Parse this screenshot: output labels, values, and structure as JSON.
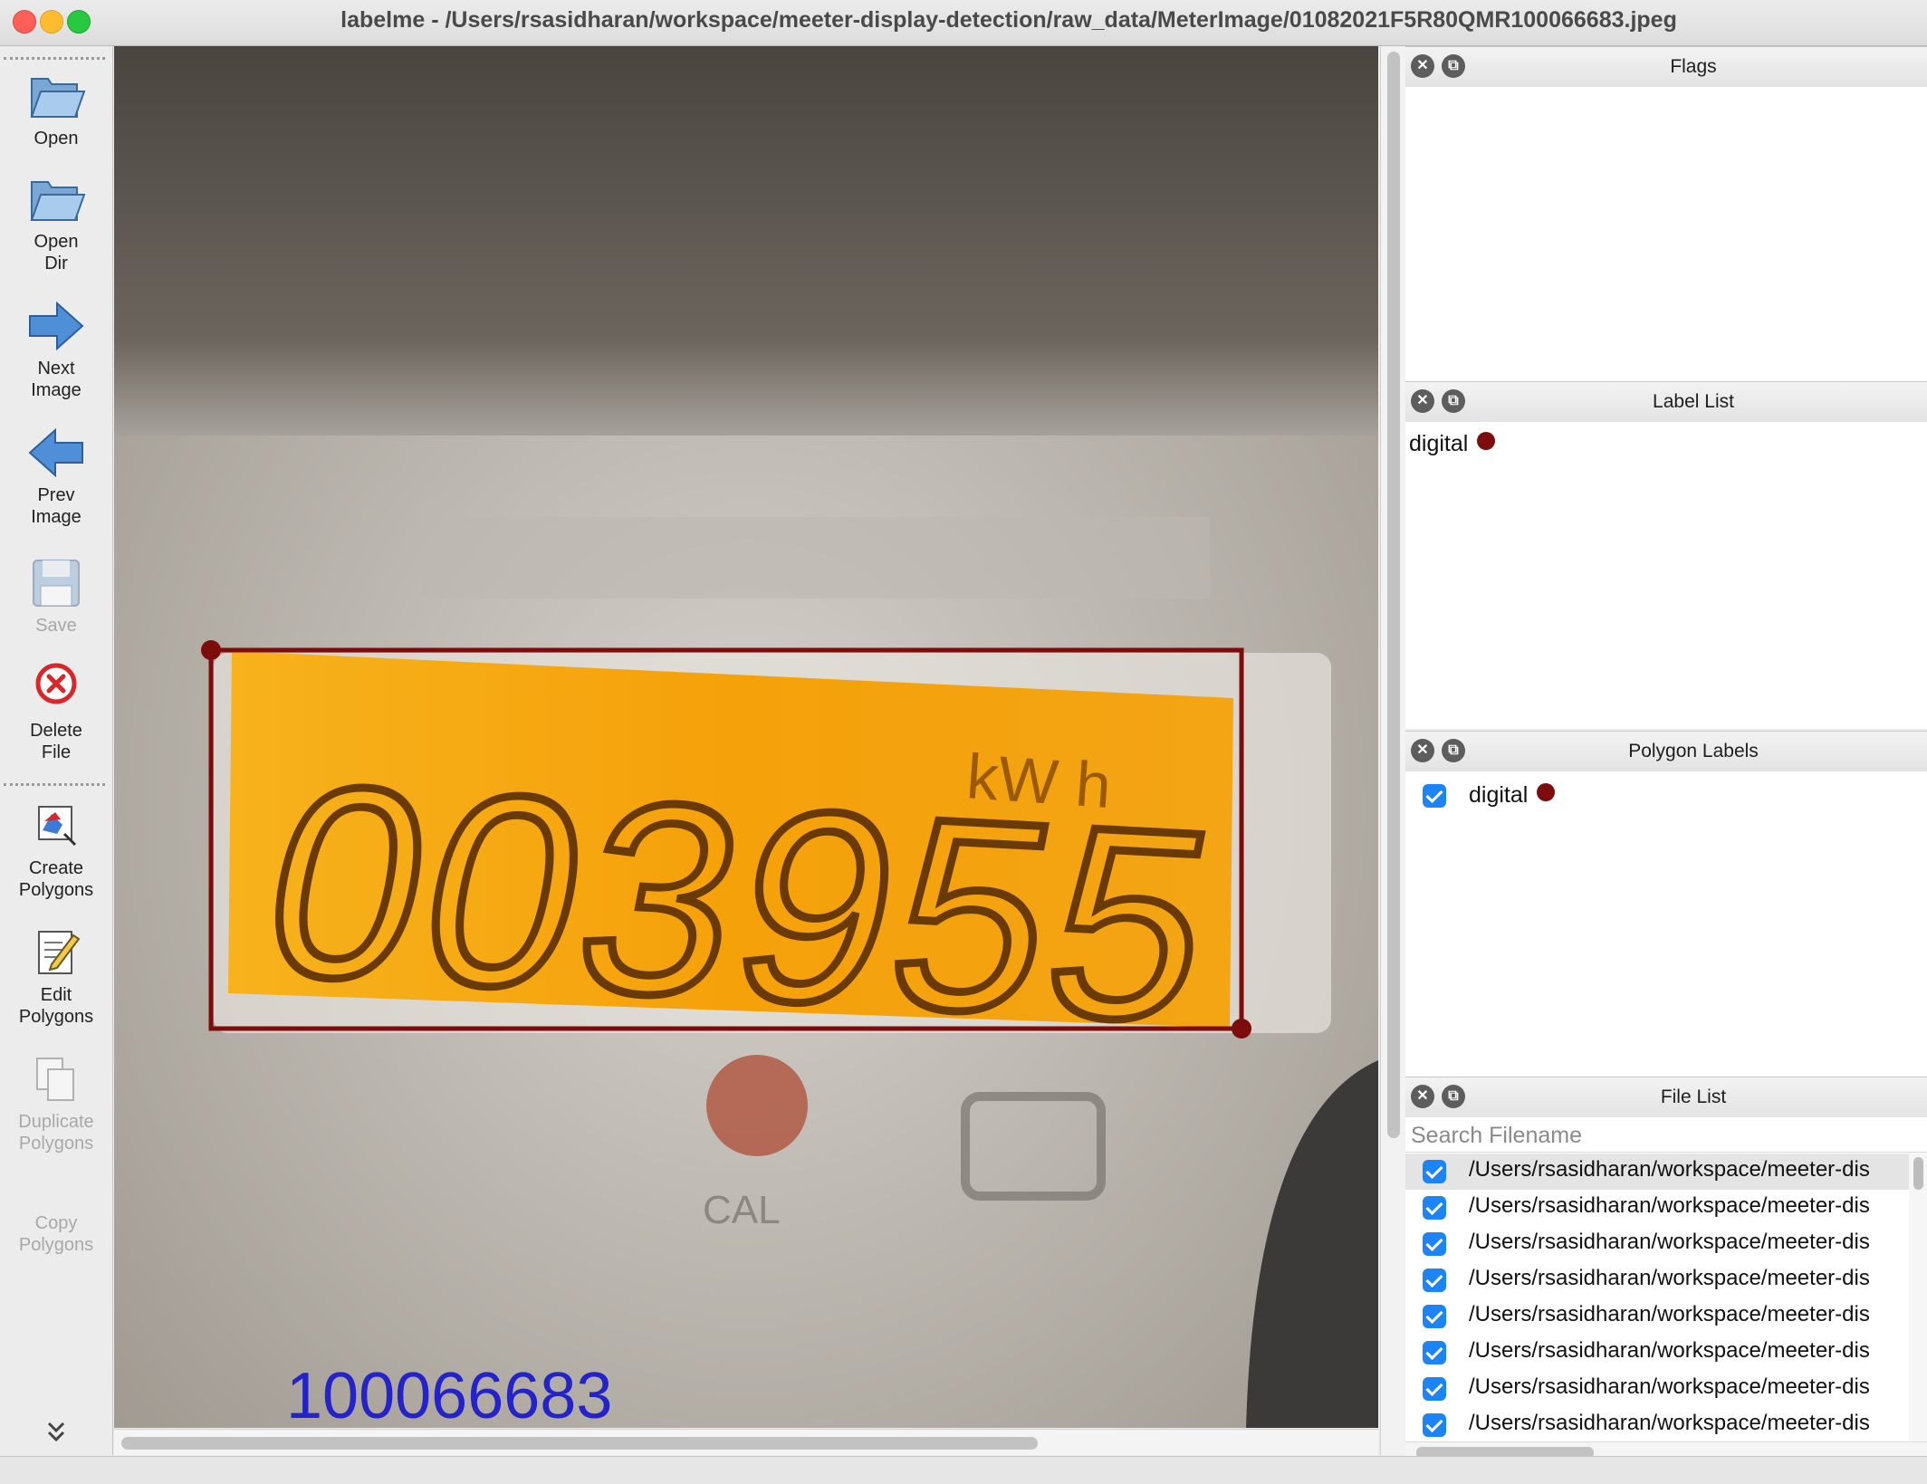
{
  "window": {
    "title": "labelme - /Users/rsasidharan/workspace/meeter-display-detection/raw_data/MeterImage/01082021F5R80QMR100066683.jpeg"
  },
  "toolbar": {
    "open": "Open",
    "open_dir_1": "Open",
    "open_dir_2": "Dir",
    "next_1": "Next",
    "next_2": "Image",
    "prev_1": "Prev",
    "prev_2": "Image",
    "save": "Save",
    "delete_1": "Delete",
    "delete_2": "File",
    "create_1": "Create",
    "create_2": "Polygons",
    "edit_1": "Edit",
    "edit_2": "Polygons",
    "duplicate_1": "Duplicate",
    "duplicate_2": "Polygons",
    "copy_1": "Copy",
    "copy_2": "Polygons",
    "icons": [
      "folder-open-icon",
      "folder-open-dir-icon",
      "arrow-right-icon",
      "arrow-left-icon",
      "floppy-save-icon",
      "delete-circle-icon",
      "create-polygon-icon",
      "edit-pencil-icon",
      "duplicate-icon",
      "chevron-double-down-icon"
    ]
  },
  "canvas": {
    "meter_reading": "003955",
    "unit": "kW h",
    "serial_overlay": "100066683",
    "cal_label": "CAL",
    "shape_label": "digital",
    "shape_color": "#7d0c0c",
    "lcd_color": "#f6a40d"
  },
  "docks": {
    "flags": {
      "title": "Flags"
    },
    "label_list": {
      "title": "Label List",
      "items": [
        {
          "label": "digital"
        }
      ]
    },
    "polygon_labels": {
      "title": "Polygon Labels",
      "items": [
        {
          "label": "digital",
          "checked": true
        }
      ]
    },
    "file_list": {
      "title": "File List",
      "search_placeholder": "Search Filename",
      "items": [
        "/Users/rsasidharan/workspace/meeter-dis",
        "/Users/rsasidharan/workspace/meeter-dis",
        "/Users/rsasidharan/workspace/meeter-dis",
        "/Users/rsasidharan/workspace/meeter-dis",
        "/Users/rsasidharan/workspace/meeter-dis",
        "/Users/rsasidharan/workspace/meeter-dis",
        "/Users/rsasidharan/workspace/meeter-dis",
        "/Users/rsasidharan/workspace/meeter-dis"
      ]
    }
  }
}
